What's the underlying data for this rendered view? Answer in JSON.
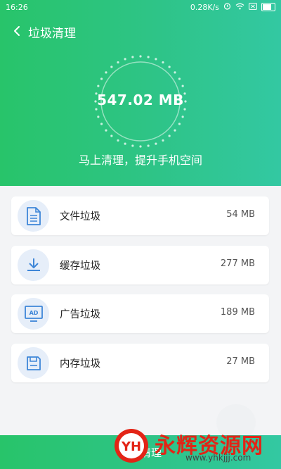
{
  "status": {
    "time": "16:26",
    "network_speed": "0.28K/s"
  },
  "header": {
    "title": "垃圾清理",
    "total_size": "547.02 MB",
    "slogan": "马上清理，提升手机空间"
  },
  "items": [
    {
      "label": "文件垃圾",
      "size": "54 MB",
      "icon": "document-icon"
    },
    {
      "label": "缓存垃圾",
      "size": "277 MB",
      "icon": "download-icon"
    },
    {
      "label": "广告垃圾",
      "size": "189 MB",
      "icon": "ad-icon"
    },
    {
      "label": "内存垃圾",
      "size": "27 MB",
      "icon": "floppy-icon"
    }
  ],
  "bottom": {
    "label": "一键清理"
  },
  "watermark": {
    "logo_text": "YH",
    "name": "永辉资源网",
    "url": "www.yhkjjj.com"
  },
  "colors": {
    "accent_start": "#28c46a",
    "accent_end": "#33c8a2",
    "icon_blue": "#3e86d8",
    "icon_bg": "#e6eef9"
  }
}
